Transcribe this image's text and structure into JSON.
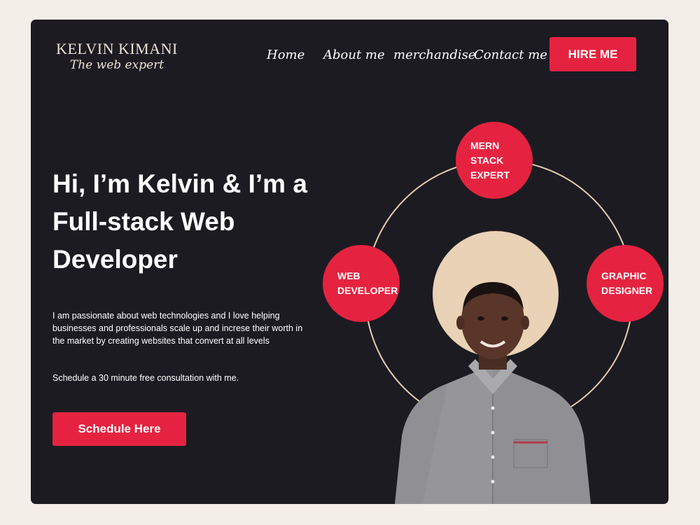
{
  "brand": {
    "name": "KELVIN KIMANI",
    "tagline": "The web expert"
  },
  "nav": {
    "items": [
      {
        "label": "Home"
      },
      {
        "label": "About me"
      },
      {
        "label": "merchandise"
      },
      {
        "label": "Contact me"
      }
    ],
    "cta_label": "HIRE ME"
  },
  "hero": {
    "headline": "Hi, I’m Kelvin & I’m a Full-stack Web Developer",
    "intro": "I am passionate about web technologies and I love helping businesses and professionals scale up and increse their worth in the market by creating websites that convert at all levels",
    "schedule_note": "Schedule a 30 minute free consultation with me.",
    "schedule_button": "Schedule Here"
  },
  "skills": [
    {
      "label": "MERN\nSTACK\nEXPERT"
    },
    {
      "label": "WEB\nDEVELOPER"
    },
    {
      "label": "GRAPHIC\nDESIGNER"
    }
  ],
  "colors": {
    "accent": "#e52340",
    "background": "#1c1b22",
    "page": "#f4eee8",
    "cream": "#e9d2b6"
  },
  "icons": {
    "portrait": "person-portrait-image"
  }
}
